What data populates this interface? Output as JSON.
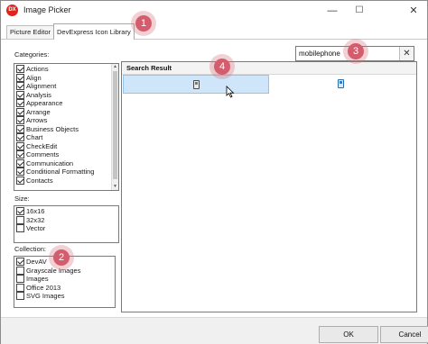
{
  "window": {
    "app_icon_label": "DX",
    "title": "Image Picker",
    "minimize_glyph": "—",
    "maximize_glyph": "☐",
    "close_glyph": "✕"
  },
  "tabs": [
    {
      "label": "Picture Editor",
      "active": false
    },
    {
      "label": "DevExpress Icon Library",
      "active": true
    }
  ],
  "categories": {
    "label": "Categories:",
    "items": [
      {
        "label": "Actions",
        "checked": true
      },
      {
        "label": "Align",
        "checked": true
      },
      {
        "label": "Alignment",
        "checked": true
      },
      {
        "label": "Analysis",
        "checked": true
      },
      {
        "label": "Appearance",
        "checked": true
      },
      {
        "label": "Arrange",
        "checked": true
      },
      {
        "label": "Arrows",
        "checked": true
      },
      {
        "label": "Business Objects",
        "checked": true
      },
      {
        "label": "Chart",
        "checked": true
      },
      {
        "label": "CheckEdit",
        "checked": true
      },
      {
        "label": "Comments",
        "checked": true
      },
      {
        "label": "Communication",
        "checked": true
      },
      {
        "label": "Conditional Formatting",
        "checked": true
      },
      {
        "label": "Contacts",
        "checked": true
      }
    ]
  },
  "size": {
    "label": "Size:",
    "items": [
      {
        "label": "16x16",
        "checked": true
      },
      {
        "label": "32x32",
        "checked": false
      },
      {
        "label": "Vector",
        "checked": false
      }
    ]
  },
  "collection": {
    "label": "Collection:",
    "items": [
      {
        "label": "DevAV",
        "checked": true
      },
      {
        "label": "Grayscale Images",
        "checked": false
      },
      {
        "label": "Images",
        "checked": false
      },
      {
        "label": "Office 2013",
        "checked": false
      },
      {
        "label": "SVG Images",
        "checked": false
      }
    ]
  },
  "search": {
    "value": "mobilephone",
    "clear_glyph": "✕"
  },
  "results": {
    "title": "Search Result",
    "items": [
      {
        "icon": "mobile-phone-icon",
        "selected": true
      },
      {
        "icon": "mobile-phone-icon",
        "selected": false
      }
    ]
  },
  "buttons": {
    "ok": "OK",
    "cancel": "Cancel"
  },
  "callouts": [
    "1",
    "2",
    "3",
    "4"
  ],
  "colors": {
    "accent_selection": "#cfe6fa",
    "callout": "#d35d6d",
    "app_icon": "#e2231a"
  }
}
